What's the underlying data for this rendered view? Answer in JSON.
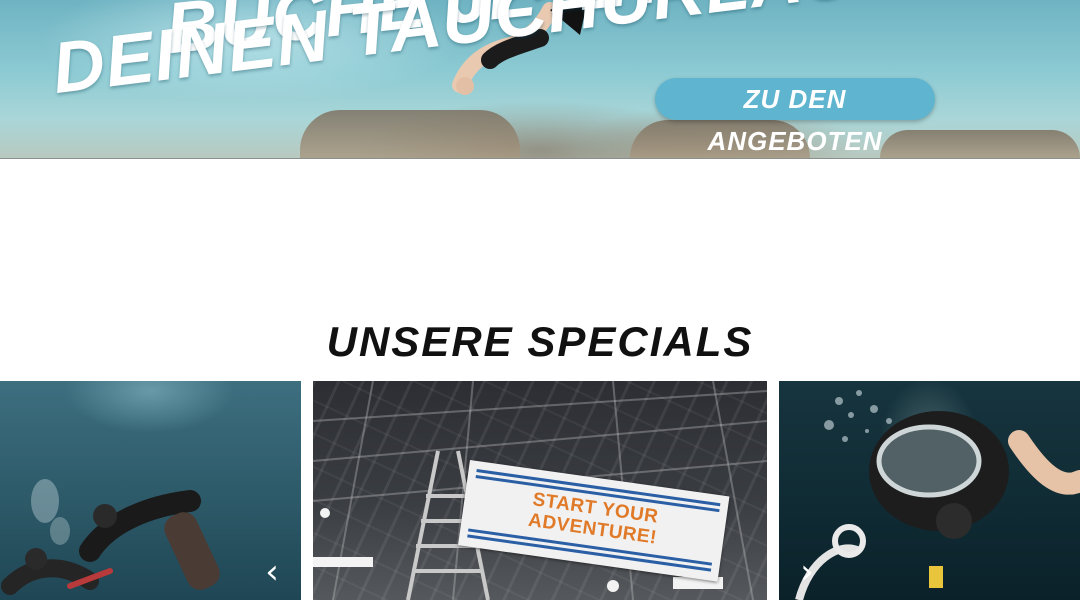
{
  "hero": {
    "title_line1": "Buche jetzt",
    "title_line2": "deinen Tauchurlaub",
    "cta_label": "Zu den Angeboten"
  },
  "specials": {
    "title": "Unsere Specials",
    "banner_line1": "START YOUR",
    "banner_line2": "ADVENTURE!",
    "prev_icon": "chevron-left-icon",
    "next_icon": "chevron-right-icon"
  },
  "colors": {
    "cta_background": "#5fb4cf",
    "banner_text": "#e07a28",
    "banner_stripe": "#2b5fa5"
  }
}
